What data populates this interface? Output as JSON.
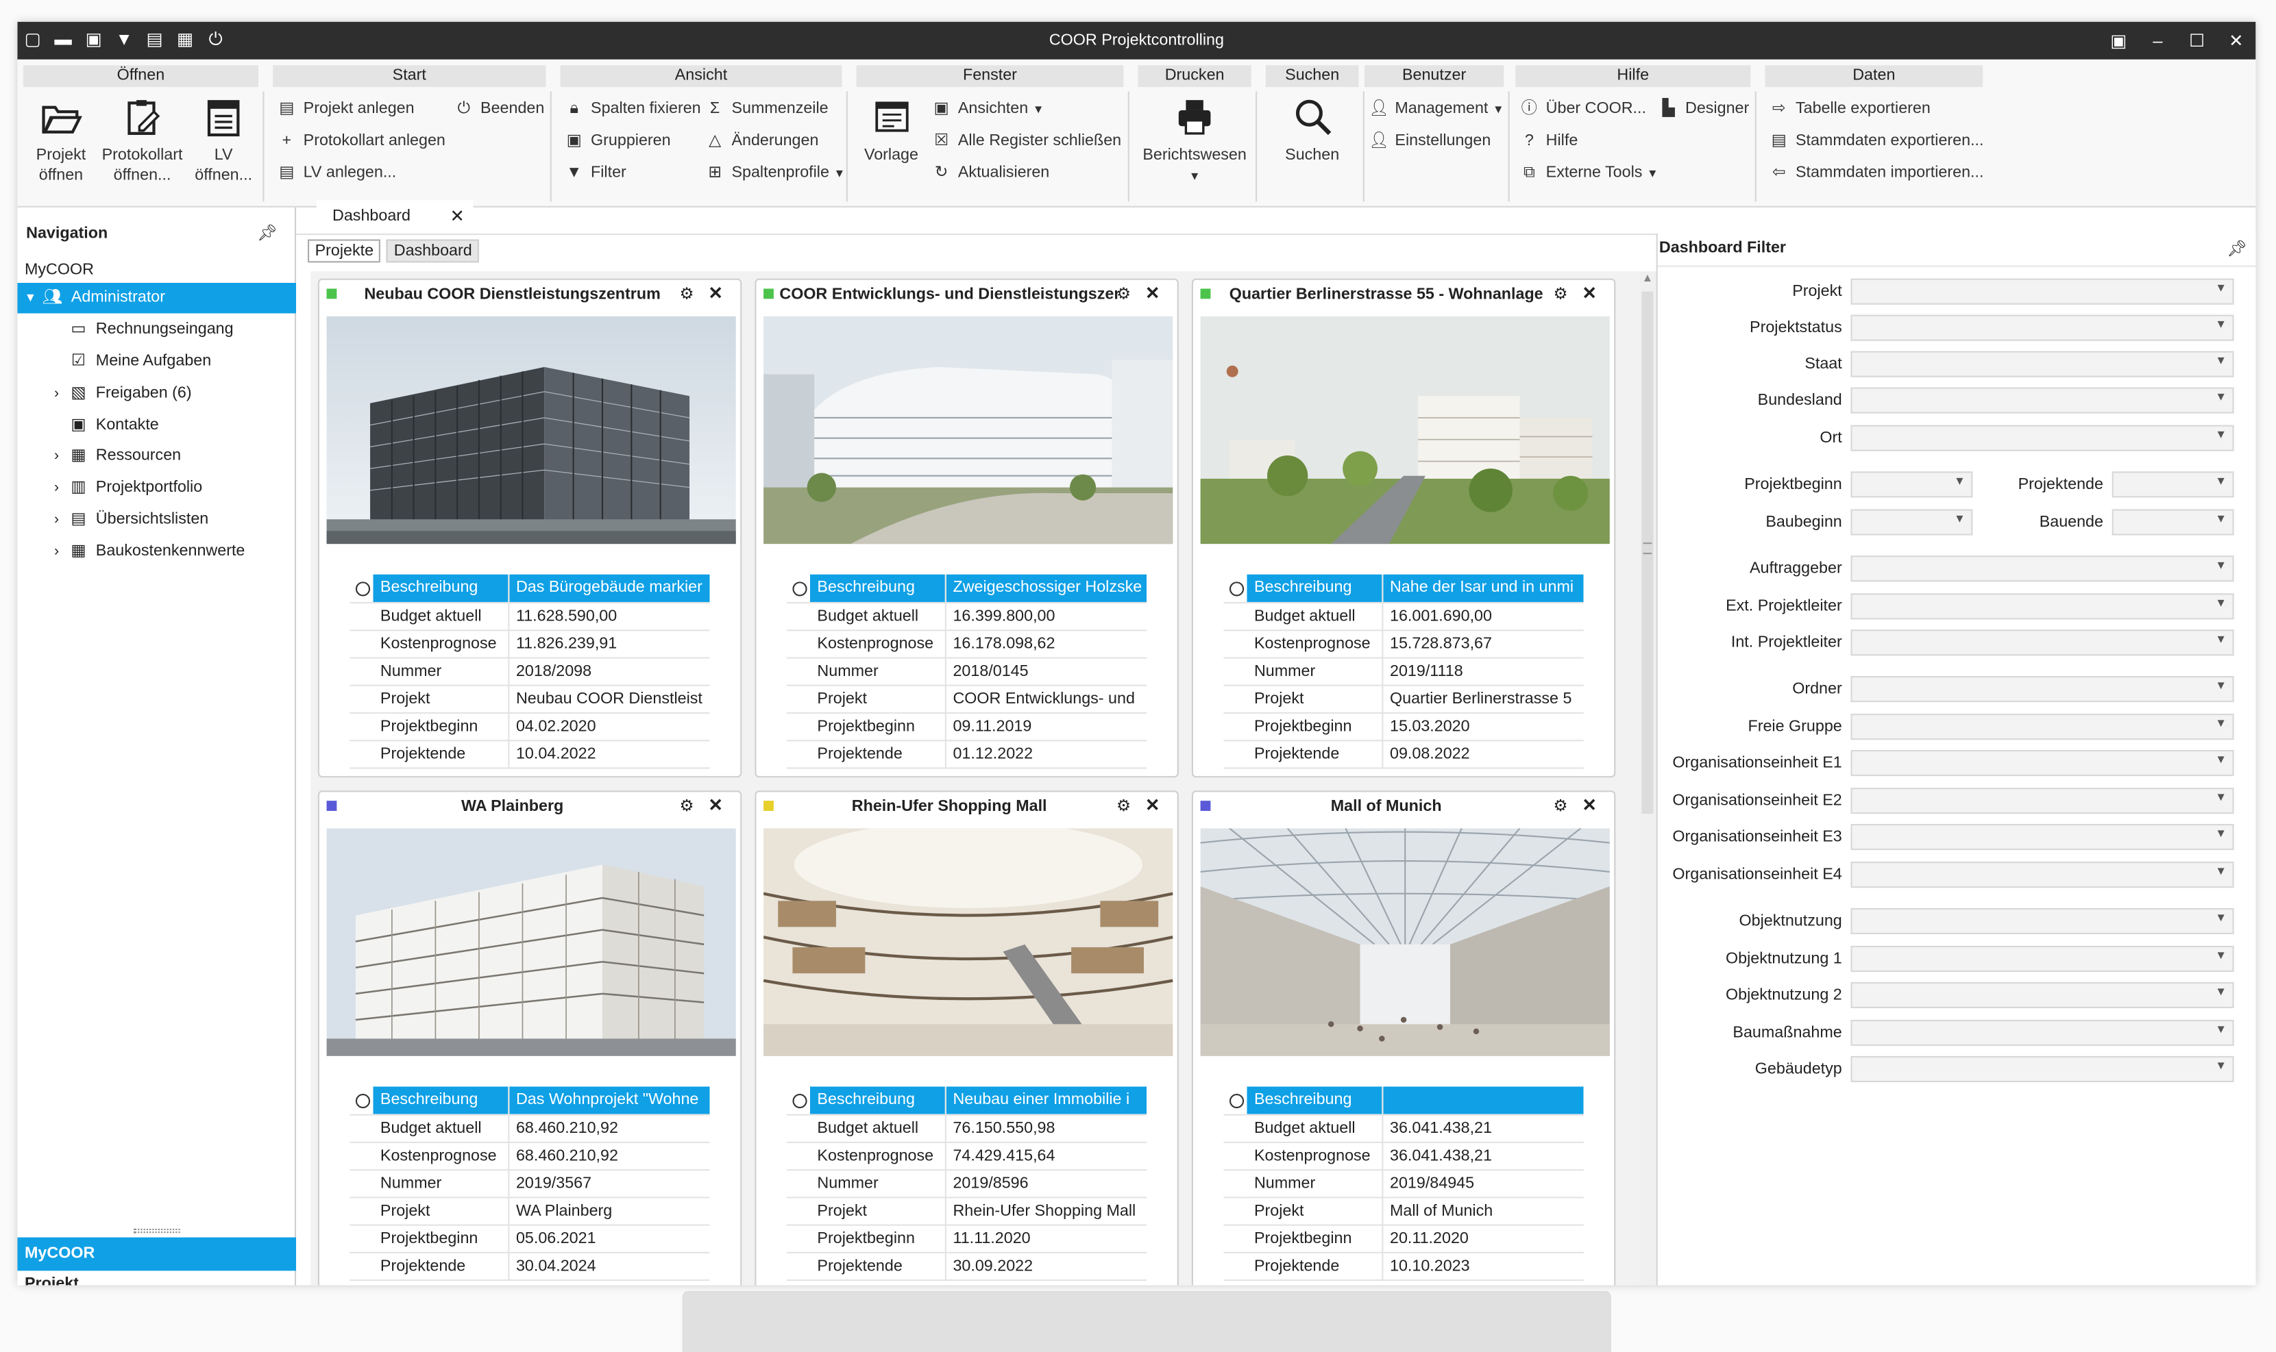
{
  "window": {
    "title": "COOR Projektcontrolling"
  },
  "ribbon": {
    "oeffnen": {
      "header": "Öffnen",
      "projekt_line1": "Projekt",
      "projekt_line2": "öffnen",
      "protokoll_line1": "Protokollart",
      "protokoll_line2": "öffnen...",
      "lv_line1": "LV",
      "lv_line2": "öffnen..."
    },
    "start": {
      "header": "Start",
      "projekt_anlegen": "Projekt anlegen",
      "beenden": "Beenden",
      "protokollart_anlegen": "Protokollart anlegen",
      "lv_anlegen": "LV anlegen..."
    },
    "ansicht": {
      "header": "Ansicht",
      "spalten_fixieren": "Spalten fixieren",
      "summenzeile": "Summenzeile",
      "gruppieren": "Gruppieren",
      "aenderungen": "Änderungen",
      "filter": "Filter",
      "spaltenprofile": "Spaltenprofile"
    },
    "fenster": {
      "header": "Fenster",
      "vorlage": "Vorlage",
      "ansichten": "Ansichten",
      "alle_register": "Alle Register schließen",
      "aktualisieren": "Aktualisieren"
    },
    "drucken": {
      "header": "Drucken",
      "berichtswesen": "Berichtswesen"
    },
    "suchen": {
      "header": "Suchen",
      "suchen": "Suchen"
    },
    "benutzer": {
      "header": "Benutzer",
      "management": "Management",
      "einstellungen": "Einstellungen"
    },
    "hilfe": {
      "header": "Hilfe",
      "ueber": "Über COOR...",
      "designer": "Designer",
      "hilfe": "Hilfe",
      "externe_tools": "Externe Tools"
    },
    "daten": {
      "header": "Daten",
      "tabelle_exportieren": "Tabelle exportieren",
      "stammdaten_exportieren": "Stammdaten exportieren...",
      "stammdaten_importieren": "Stammdaten importieren..."
    }
  },
  "navigation": {
    "header": "Navigation",
    "root": "MyCOOR",
    "items": [
      {
        "label": "Administrator",
        "selected": true,
        "icon": "users-icon"
      },
      {
        "label": "Rechnungseingang",
        "icon": "inbox-icon"
      },
      {
        "label": "Meine Aufgaben",
        "icon": "checklist-icon"
      },
      {
        "label": "Freigaben (6)",
        "icon": "approval-icon"
      },
      {
        "label": "Kontakte",
        "icon": "contact-card-icon"
      },
      {
        "label": "Ressourcen",
        "icon": "calendar-icon"
      },
      {
        "label": "Projektportfolio",
        "icon": "buildings-icon"
      },
      {
        "label": "Übersichtslisten",
        "icon": "document-list-icon"
      },
      {
        "label": "Baukostenkennwerte",
        "icon": "table-grid-icon"
      }
    ],
    "bottom_active": "MyCOOR",
    "bottom_next": "Projekt"
  },
  "document_tab": {
    "label": "Dashboard"
  },
  "subtabs": [
    "Projekte",
    "Dashboard"
  ],
  "field_labels": [
    "Beschreibung",
    "Budget aktuell",
    "Kostenprognose",
    "Nummer",
    "Projekt",
    "Projektbeginn",
    "Projektende"
  ],
  "projects": [
    {
      "title": "Neubau COOR Dienstleistungszentrum",
      "status_color": "#4cc44c",
      "values": [
        "Das Bürogebäude markier",
        "11.628.590,00",
        "11.826.239,91",
        "2018/2098",
        "Neubau COOR Dienstleist",
        "04.02.2020",
        "10.04.2022"
      ]
    },
    {
      "title": "COOR Entwicklungs- und Dienstleistungszentru",
      "status_color": "#4cc44c",
      "values": [
        "Zweigeschossiger Holzske",
        "16.399.800,00",
        "16.178.098,62",
        "2018/0145",
        "COOR Entwicklungs- und",
        "09.11.2019",
        "01.12.2022"
      ]
    },
    {
      "title": "Quartier Berlinerstrasse 55 - Wohnanlage",
      "status_color": "#4cc44c",
      "values": [
        "Nahe der Isar und in unmi",
        "16.001.690,00",
        "15.728.873,67",
        "2019/1118",
        "Quartier Berlinerstrasse 5",
        "15.03.2020",
        "09.08.2022"
      ]
    },
    {
      "title": "WA Plainberg",
      "status_color": "#5a5ad8",
      "values": [
        "Das Wohnprojekt \"Wohne",
        "68.460.210,92",
        "68.460.210,92",
        "2019/3567",
        "WA Plainberg",
        "05.06.2021",
        "30.04.2024"
      ]
    },
    {
      "title": "Rhein-Ufer Shopping Mall",
      "status_color": "#e8d02a",
      "values": [
        "Neubau einer Immobilie i",
        "76.150.550,98",
        "74.429.415,64",
        "2019/8596",
        "Rhein-Ufer Shopping Mall",
        "11.11.2020",
        "30.09.2022"
      ]
    },
    {
      "title": "Mall of Munich",
      "status_color": "#5a5ad8",
      "values": [
        "",
        "36.041.438,21",
        "36.041.438,21",
        "2019/84945",
        "Mall of Munich",
        "20.11.2020",
        "10.10.2023"
      ]
    }
  ],
  "filter": {
    "header": "Dashboard Filter",
    "fields": {
      "projekt": "Projekt",
      "projektstatus": "Projektstatus",
      "staat": "Staat",
      "bundesland": "Bundesland",
      "ort": "Ort",
      "projektbeginn": "Projektbeginn",
      "projektende": "Projektende",
      "baubeginn": "Baubeginn",
      "bauende": "Bauende",
      "auftraggeber": "Auftraggeber",
      "ext_projektleiter": "Ext. Projektleiter",
      "int_projektleiter": "Int. Projektleiter",
      "ordner": "Ordner",
      "freie_gruppe": "Freie Gruppe",
      "org_e1": "Organisationseinheit E1",
      "org_e2": "Organisationseinheit E2",
      "org_e3": "Organisationseinheit E3",
      "org_e4": "Organisationseinheit E4",
      "objektnutzung": "Objektnutzung",
      "objektnutzung1": "Objektnutzung 1",
      "objektnutzung2": "Objektnutzung 2",
      "baumassnahme": "Baumaßnahme",
      "gebaeudetyp": "Gebäudetyp"
    }
  },
  "colors": {
    "accent": "#0fa0e6",
    "titlebar": "#2e2e2e"
  }
}
